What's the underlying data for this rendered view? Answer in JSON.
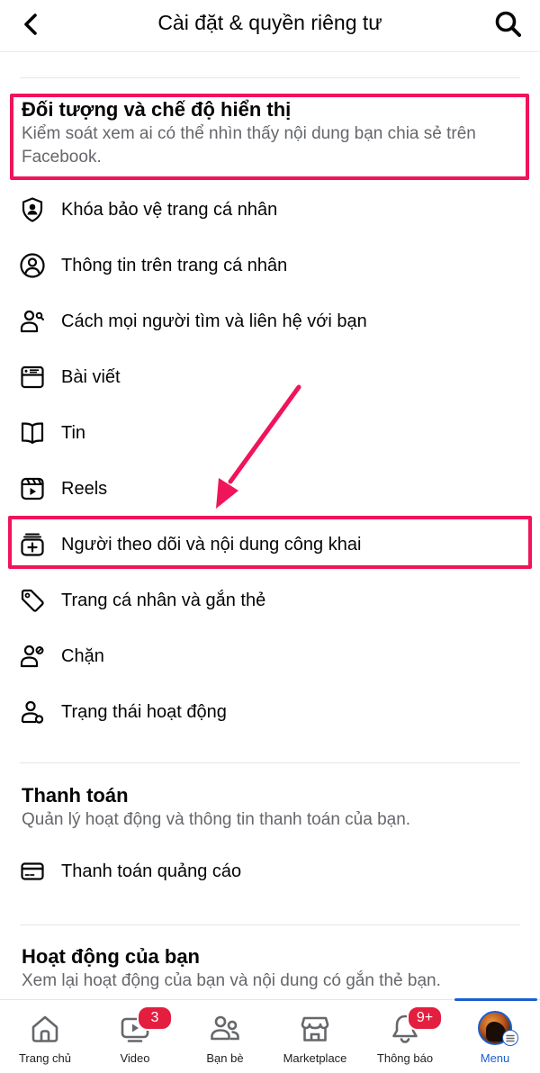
{
  "header": {
    "title": "Cài đặt & quyền riêng tư",
    "back_icon": "chevron-left-icon",
    "search_icon": "search-icon"
  },
  "audience_section": {
    "title": "Đối tượng và chế độ hiển thị",
    "subtitle_line1": "Kiểm soát xem ai có thể nhìn thấy nội dung bạn chia sẻ trên",
    "subtitle_line2": "Facebook.",
    "items": [
      {
        "label": "Khóa bảo vệ trang cá nhân",
        "icon": "shield-person-icon"
      },
      {
        "label": "Thông tin trên trang cá nhân",
        "icon": "person-circle-icon"
      },
      {
        "label": "Cách mọi người tìm và liên hệ với bạn",
        "icon": "person-search-icon"
      },
      {
        "label": "Bài viết",
        "icon": "post-icon"
      },
      {
        "label": "Tin",
        "icon": "book-icon"
      },
      {
        "label": "Reels",
        "icon": "reels-icon"
      },
      {
        "label": "Người theo dõi và nội dung công khai",
        "icon": "stack-plus-icon"
      },
      {
        "label": "Trang cá nhân và gắn thẻ",
        "icon": "tag-icon"
      },
      {
        "label": "Chặn",
        "icon": "person-block-icon"
      },
      {
        "label": "Trạng thái hoạt động",
        "icon": "person-status-icon"
      }
    ]
  },
  "payments_section": {
    "title": "Thanh toán",
    "subtitle": "Quản lý hoạt động và thông tin thanh toán của bạn.",
    "items": [
      {
        "label": "Thanh toán quảng cáo",
        "icon": "credit-card-icon"
      }
    ]
  },
  "activity_section": {
    "title": "Hoạt động của bạn",
    "subtitle": "Xem lại hoạt động của bạn và nội dung có gắn thẻ bạn."
  },
  "annotation": {
    "highlight_color": "#f0145a"
  },
  "bottom_nav": {
    "tabs": [
      {
        "label": "Trang chủ",
        "icon": "home-icon"
      },
      {
        "label": "Video",
        "icon": "video-icon",
        "badge": "3"
      },
      {
        "label": "Bạn bè",
        "icon": "friends-icon"
      },
      {
        "label": "Marketplace",
        "icon": "marketplace-icon"
      },
      {
        "label": "Thông báo",
        "icon": "bell-icon",
        "badge": "9+"
      },
      {
        "label": "Menu",
        "icon": "avatar-menu-icon",
        "active": true
      }
    ],
    "active_color": "#1b5fcf",
    "badge_color": "#e41e3f"
  }
}
